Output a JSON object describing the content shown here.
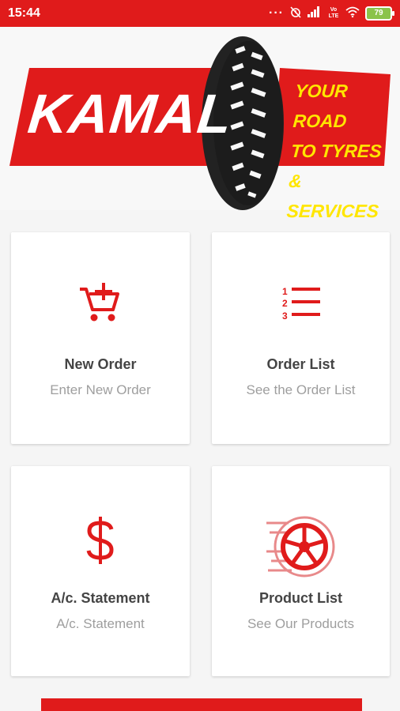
{
  "status_bar": {
    "time": "15:44",
    "battery": "79",
    "network_label": "Vo LTE",
    "icons": [
      "more-dots-icon",
      "alarm-off-icon",
      "signal-icon",
      "volte-icon",
      "wifi-icon",
      "battery-icon"
    ]
  },
  "logo": {
    "brand": "KAMAL",
    "tagline": [
      "YOUR ROAD",
      "TO TYRES &",
      "SERVICES"
    ]
  },
  "cards": [
    {
      "title": "New Order",
      "subtitle": "Enter New Order",
      "icon": "add-to-cart-icon"
    },
    {
      "title": "Order List",
      "subtitle": "See the Order List",
      "icon": "numbered-list-icon"
    },
    {
      "title": "A/c. Statement",
      "subtitle": "A/c. Statement",
      "icon": "dollar-icon"
    },
    {
      "title": "Product List",
      "subtitle": "See Our Products",
      "icon": "speeding-wheel-icon"
    }
  ],
  "colors": {
    "brand_red": "#e01b1b",
    "tagline_yellow": "#ffe600",
    "card_title": "#444444",
    "card_subtitle": "#9e9e9e"
  }
}
